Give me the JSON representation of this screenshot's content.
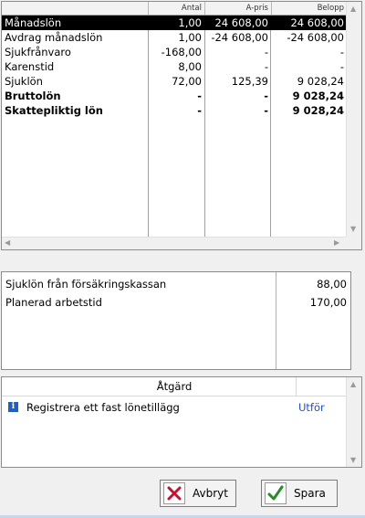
{
  "grid": {
    "headers": [
      "Antal",
      "A-pris",
      "Belopp"
    ],
    "rows": [
      {
        "name": "Månadslön",
        "antal": "1,00",
        "apris": "24 608,00",
        "belopp": "24 608,00",
        "selected": true,
        "bold": false
      },
      {
        "name": "Avdrag månadslön",
        "antal": "1,00",
        "apris": "-24 608,00",
        "belopp": "-24 608,00",
        "selected": false,
        "bold": false
      },
      {
        "name": "Sjukfrånvaro",
        "antal": "-168,00",
        "apris": "-",
        "belopp": "-",
        "selected": false,
        "bold": false
      },
      {
        "name": "Karenstid",
        "antal": "8,00",
        "apris": "-",
        "belopp": "-",
        "selected": false,
        "bold": false
      },
      {
        "name": "Sjuklön",
        "antal": "72,00",
        "apris": "125,39",
        "belopp": "9 028,24",
        "selected": false,
        "bold": false
      },
      {
        "name": "Bruttolön",
        "antal": "-",
        "apris": "-",
        "belopp": "9 028,24",
        "selected": false,
        "bold": true
      },
      {
        "name": "Skattepliktig lön",
        "antal": "-",
        "apris": "-",
        "belopp": "9 028,24",
        "selected": false,
        "bold": true
      }
    ]
  },
  "info": {
    "rows": [
      {
        "label": "Sjuklön från försäkringskassan",
        "value": "88,00"
      },
      {
        "label": "Planerad arbetstid",
        "value": "170,00"
      }
    ]
  },
  "actions": {
    "header": "Åtgärd",
    "items": [
      {
        "icon": "info-icon",
        "label": "Registrera ett fast lönetillägg",
        "link": "Utför"
      }
    ]
  },
  "buttons": {
    "cancel": "Avbryt",
    "save": "Spara"
  },
  "colors": {
    "link": "#1f4fd8",
    "selection": "#000000",
    "info_icon": "#1f5fc7"
  }
}
